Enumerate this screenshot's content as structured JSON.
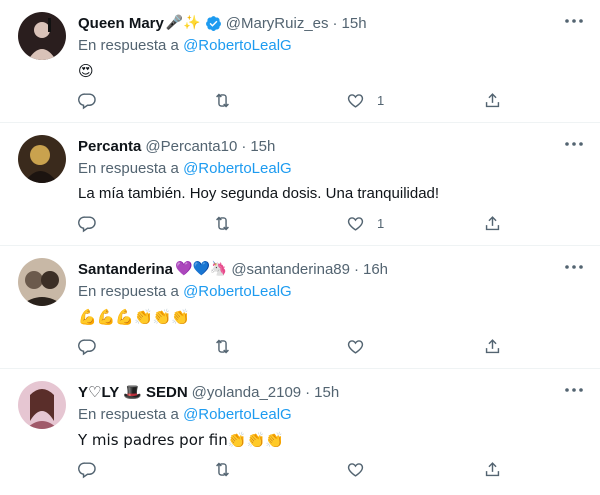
{
  "tweets": [
    {
      "name": "Queen Mary",
      "name_emoji": "🎤✨",
      "verified": true,
      "handle": "@MaryRuiz_es",
      "time": "15h",
      "reply_prefix": "En respuesta a",
      "reply_user": "@RobertoLealG",
      "text": "😍",
      "likes": "1",
      "avatar_colors": [
        "#2a1e1e",
        "#d9c2b8"
      ]
    },
    {
      "name": "Percanta",
      "name_emoji": "",
      "verified": false,
      "handle": "@Percanta10",
      "time": "15h",
      "reply_prefix": "En respuesta a",
      "reply_user": "@RobertoLealG",
      "text": "La mía también. Hoy segunda dosis. Una tranquilidad!",
      "likes": "1",
      "avatar_colors": [
        "#c9a24e",
        "#3a2a1c"
      ]
    },
    {
      "name": "Santanderina",
      "name_emoji": "💜💙🦄",
      "verified": false,
      "handle": "@santanderina89",
      "time": "16h",
      "reply_prefix": "En respuesta a",
      "reply_user": "@RobertoLealG",
      "text": "💪💪💪👏👏👏",
      "likes": "",
      "avatar_colors": [
        "#6b5a4c",
        "#c8b8a6"
      ]
    },
    {
      "name": "Y♡LY 🎩 SEDN",
      "name_emoji": "",
      "verified": false,
      "handle": "@yolanda_2109",
      "time": "15h",
      "reply_prefix": "En respuesta a",
      "reply_user": "@RobertoLealG",
      "text": "Y mis padres por fin👏👏👏",
      "likes": "",
      "avatar_colors": [
        "#e6c6d2",
        "#5a2e2a"
      ]
    }
  ],
  "icons": {
    "reply": "reply-icon",
    "retweet": "retweet-icon",
    "like": "heart-icon",
    "share": "share-icon",
    "more": "more-options-icon",
    "verified": "verified-badge-icon"
  },
  "colors": {
    "link": "#1d9bf0",
    "secondary": "#536471",
    "verified": "#1d9bf0",
    "divider": "#eff3f4"
  }
}
